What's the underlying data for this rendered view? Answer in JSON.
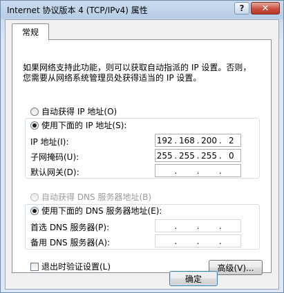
{
  "window": {
    "title": "Internet 协议版本 4 (TCP/IPv4) 属性",
    "help_label": "?",
    "close_label": "✕"
  },
  "tabs": [
    {
      "label": "常规"
    }
  ],
  "description": {
    "line1": "如果网络支持此功能，则可以获取自动指派的 IP 设置。否则，",
    "line2": "您需要从网络系统管理员处获得适当的 IP 设置。"
  },
  "ip_section": {
    "auto_label": "自动获得 IP 地址(O)",
    "manual_label": "使用下面的 IP 地址(S):",
    "selected": "manual",
    "fields": [
      {
        "label": "IP 地址(I):",
        "value": [
          "192",
          "168",
          "200",
          "2"
        ]
      },
      {
        "label": "子网掩码(U):",
        "value": [
          "255",
          "255",
          "255",
          "0"
        ]
      },
      {
        "label": "默认网关(D):",
        "value": [
          "",
          "",
          "",
          ""
        ]
      }
    ]
  },
  "dns_section": {
    "auto_label": "自动获得 DNS 服务器地址(B)",
    "manual_label": "使用下面的 DNS 服务器地址(E):",
    "selected": "manual",
    "fields": [
      {
        "label": "首选 DNS 服务器(P):",
        "value": [
          "",
          "",
          "",
          ""
        ]
      },
      {
        "label": "备用 DNS 服务器(A):",
        "value": [
          "",
          "",
          "",
          ""
        ]
      }
    ]
  },
  "validate_on_exit": {
    "label": "退出时验证设置(L)",
    "checked": false
  },
  "buttons": {
    "advanced": "高级(V)...",
    "ok": "确定"
  }
}
